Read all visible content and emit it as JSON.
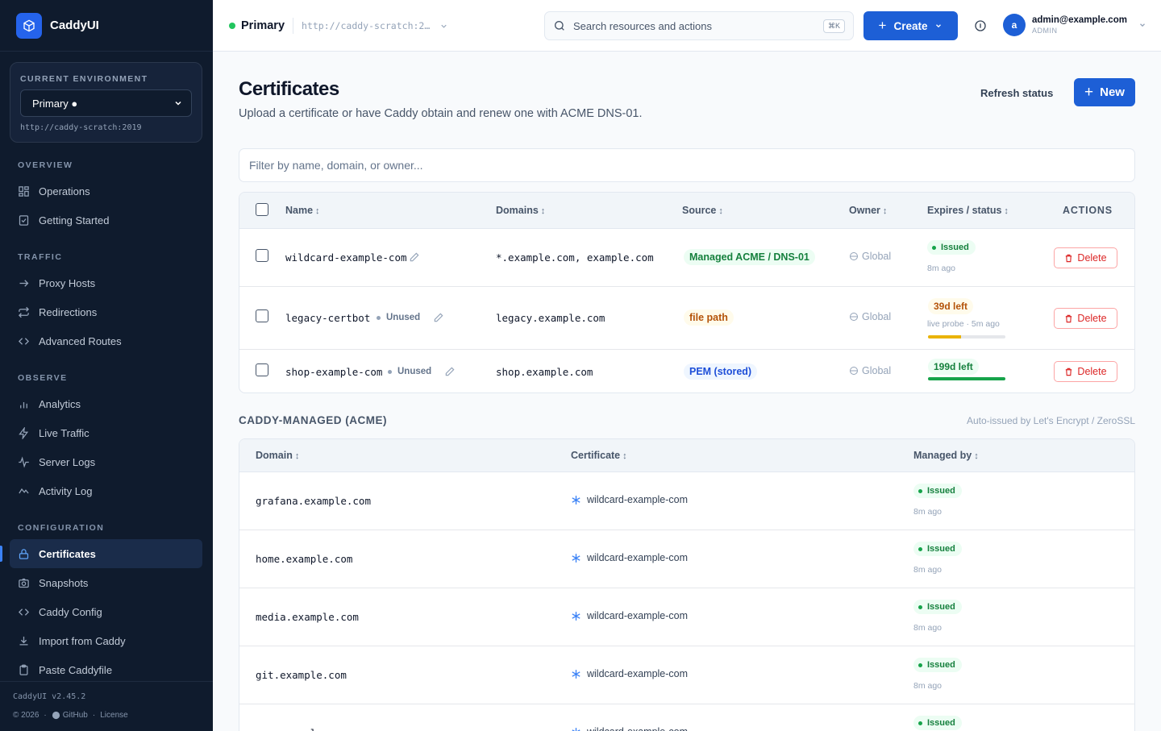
{
  "app": {
    "name": "CaddyUI",
    "version": "CaddyUI v2.45.2",
    "copyright": "© 2026",
    "github": "GitHub",
    "license": "License"
  },
  "sidebar": {
    "env_label": "CURRENT ENVIRONMENT",
    "env_value": "Primary ●",
    "env_url": "http://caddy-scratch:2019",
    "sections": {
      "overview": "OVERVIEW",
      "traffic": "TRAFFIC",
      "observe": "OBSERVE",
      "configuration": "CONFIGURATION"
    },
    "items": {
      "operations": "Operations",
      "getting_started": "Getting Started",
      "proxy_hosts": "Proxy Hosts",
      "redirections": "Redirections",
      "advanced_routes": "Advanced Routes",
      "analytics": "Analytics",
      "live_traffic": "Live Traffic",
      "server_logs": "Server Logs",
      "activity_log": "Activity Log",
      "certificates": "Certificates",
      "snapshots": "Snapshots",
      "caddy_config": "Caddy Config",
      "import": "Import from Caddy",
      "paste": "Paste Caddyfile"
    }
  },
  "topbar": {
    "env_name": "Primary",
    "env_url": "http://caddy-scratch:2…",
    "search_placeholder": "Search resources and actions",
    "shortcut": "⌘K",
    "create": "Create",
    "user_initial": "a",
    "user_email": "admin@example.com",
    "user_role": "ADMIN"
  },
  "page": {
    "title": "Certificates",
    "subtitle": "Upload a certificate or have Caddy obtain and renew one with ACME DNS-01.",
    "refresh": "Refresh status",
    "new": "New",
    "filter_placeholder": "Filter by name, domain, or owner..."
  },
  "certs": {
    "headers": {
      "name": "Name",
      "domains": "Domains",
      "source": "Source",
      "owner": "Owner",
      "expires": "Expires / status",
      "actions": "ACTIONS"
    },
    "rows": [
      {
        "name": "wildcard-example-com",
        "unused": "",
        "domains": "*.example.com, example.com",
        "source": "Managed ACME / DNS-01",
        "owner": "Global",
        "status": "Issued",
        "sub": "8m ago",
        "delete": "Delete"
      },
      {
        "name": "legacy-certbot",
        "unused": "Unused",
        "domains": "legacy.example.com",
        "source": "file path",
        "owner": "Global",
        "status": "39d left",
        "sub": "live probe · 5m ago",
        "progress": 0.43,
        "delete": "Delete"
      },
      {
        "name": "shop-example-com",
        "unused": "Unused",
        "domains": "shop.example.com",
        "source": "PEM (stored)",
        "owner": "Global",
        "status": "199d left",
        "progress": 1.0,
        "delete": "Delete"
      }
    ],
    "colors": {
      "managed_bg": "#ecfdf3",
      "managed_fg": "#15803d",
      "file_bg": "#fffbeb",
      "file_fg": "#b45309",
      "pem_bg": "#eff6ff",
      "pem_fg": "#1d4ed8",
      "warn": "#eab308",
      "ok": "#16a34a"
    }
  },
  "acme": {
    "title": "CADDY-MANAGED (ACME)",
    "note": "Auto-issued by Let's Encrypt / ZeroSSL",
    "headers": {
      "domain": "Domain",
      "certificate": "Certificate",
      "managed_by": "Managed by"
    },
    "rows": [
      {
        "domain": "grafana.example.com",
        "cert": "wildcard-example-com",
        "status": "Issued",
        "sub": "8m ago"
      },
      {
        "domain": "home.example.com",
        "cert": "wildcard-example-com",
        "status": "Issued",
        "sub": "8m ago"
      },
      {
        "domain": "media.example.com",
        "cert": "wildcard-example-com",
        "status": "Issued",
        "sub": "8m ago"
      },
      {
        "domain": "git.example.com",
        "cert": "wildcard-example-com",
        "status": "Issued",
        "sub": "8m ago"
      },
      {
        "domain": "app.example.com",
        "cert": "wildcard-example-com",
        "status": "Issued",
        "sub": ""
      }
    ]
  }
}
